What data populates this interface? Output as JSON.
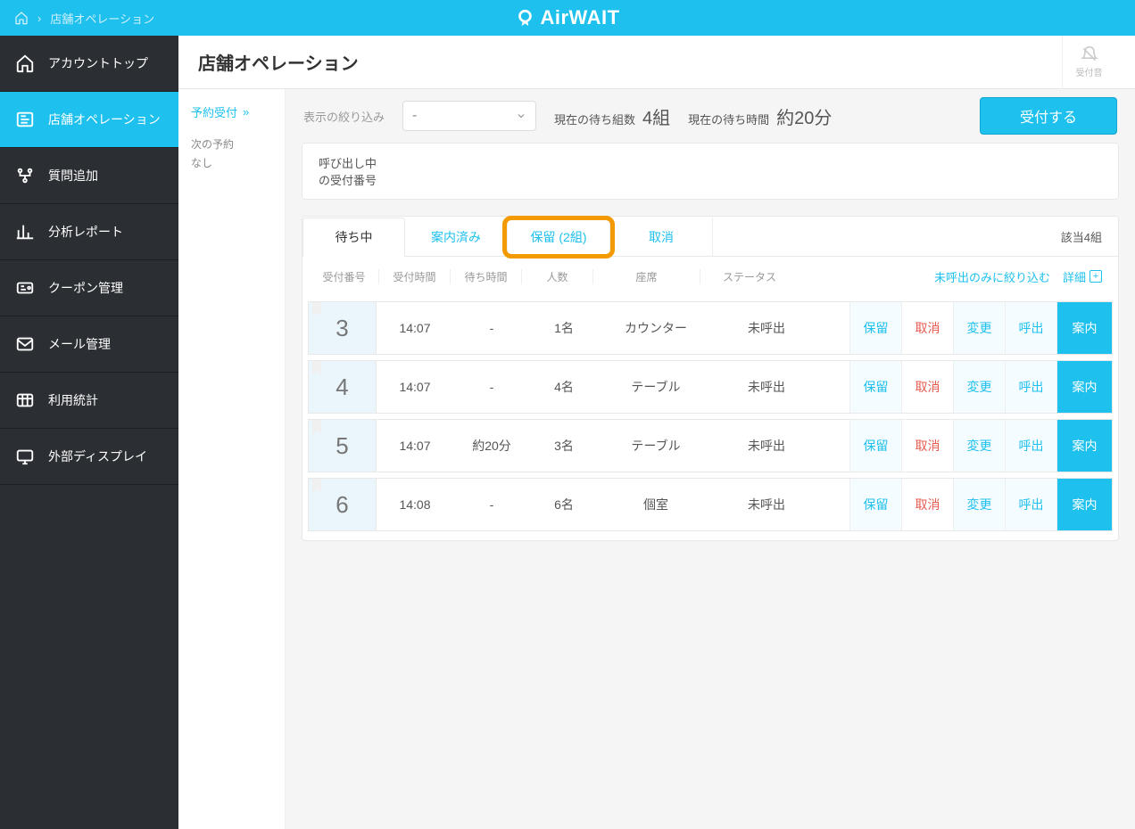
{
  "breadcrumb": {
    "current": "店舗オペレーション"
  },
  "logo": {
    "text": "AirWAIT"
  },
  "sidebar": {
    "items": [
      {
        "label": "アカウントトップ"
      },
      {
        "label": "店舗オペレーション"
      },
      {
        "label": "質問追加"
      },
      {
        "label": "分析レポート"
      },
      {
        "label": "クーポン管理"
      },
      {
        "label": "メール管理"
      },
      {
        "label": "利用統計"
      },
      {
        "label": "外部ディスプレイ"
      }
    ],
    "active_index": 1
  },
  "header": {
    "title": "店舗オペレーション",
    "bell_label": "受付音"
  },
  "subnav": {
    "selected": "予約受付",
    "next_label": "次の予約",
    "next_value": "なし"
  },
  "filterbar": {
    "label": "表示の絞り込み",
    "select_value": "-",
    "wait_groups_label": "現在の待ち組数",
    "wait_groups_value": "4組",
    "wait_time_label": "現在の待ち時間",
    "wait_time_value": "約20分",
    "accept_button": "受付する"
  },
  "callout": {
    "line1": "呼び出し中",
    "line2": "の受付番号"
  },
  "tabs": {
    "items": [
      {
        "label": "待ち中"
      },
      {
        "label": "案内済み"
      },
      {
        "label": "保留 (2組)"
      },
      {
        "label": "取消"
      }
    ],
    "active_index": 0,
    "highlight_index": 2,
    "match_count": "該当4組"
  },
  "columns": {
    "num": "受付番号",
    "time": "受付時間",
    "wait": "待ち時間",
    "ppl": "人数",
    "seat": "座席",
    "status": "ステータス",
    "filter_link": "未呼出のみに絞り込む",
    "detail_link": "詳細"
  },
  "actions": {
    "hold": "保留",
    "cancel": "取消",
    "change": "変更",
    "call": "呼出",
    "guide": "案内"
  },
  "rows": [
    {
      "num": "3",
      "time": "14:07",
      "wait": "-",
      "ppl": "1名",
      "seat": "カウンター",
      "status": "未呼出"
    },
    {
      "num": "4",
      "time": "14:07",
      "wait": "-",
      "ppl": "4名",
      "seat": "テーブル",
      "status": "未呼出"
    },
    {
      "num": "5",
      "time": "14:07",
      "wait": "約20分",
      "ppl": "3名",
      "seat": "テーブル",
      "status": "未呼出"
    },
    {
      "num": "6",
      "time": "14:08",
      "wait": "-",
      "ppl": "6名",
      "seat": "個室",
      "status": "未呼出"
    }
  ]
}
